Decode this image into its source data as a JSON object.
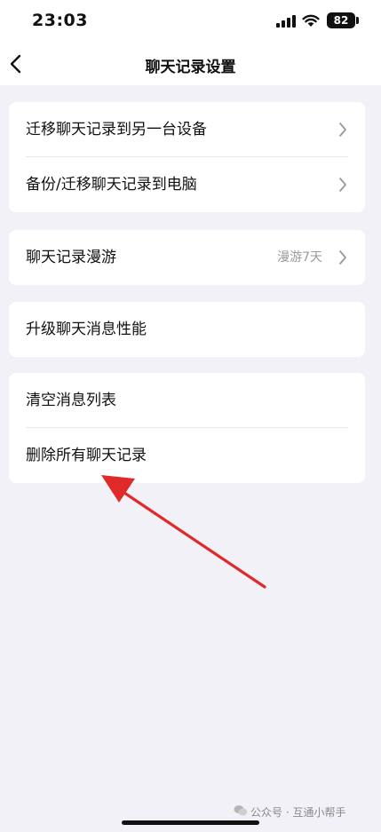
{
  "status_bar": {
    "time": "23:03",
    "battery": "82",
    "icons": [
      "signal-icon",
      "wifi-icon",
      "battery-icon"
    ]
  },
  "nav": {
    "title": "聊天记录设置",
    "back_icon": "chevron-left-icon"
  },
  "groups": [
    {
      "items": [
        {
          "label": "迁移聊天记录到另一台设备",
          "value": "",
          "chevron": true
        },
        {
          "label": "备份/迁移聊天记录到电脑",
          "value": "",
          "chevron": true
        }
      ]
    },
    {
      "items": [
        {
          "label": "聊天记录漫游",
          "value": "漫游7天",
          "chevron": true
        }
      ]
    },
    {
      "items": [
        {
          "label": "升级聊天消息性能",
          "value": "",
          "chevron": false
        }
      ]
    },
    {
      "items": [
        {
          "label": "清空消息列表",
          "value": "",
          "chevron": false
        },
        {
          "label": "删除所有聊天记录",
          "value": "",
          "chevron": false
        }
      ]
    }
  ],
  "annotation": {
    "color": "#e02a2a",
    "icon": "red-arrow"
  },
  "watermark": {
    "text": "公众号 · 互通小帮手",
    "icon": "wechat-icon"
  },
  "colors": {
    "background": "#f2f1f7",
    "card": "#ffffff",
    "secondary_text": "#9a9a9a"
  }
}
